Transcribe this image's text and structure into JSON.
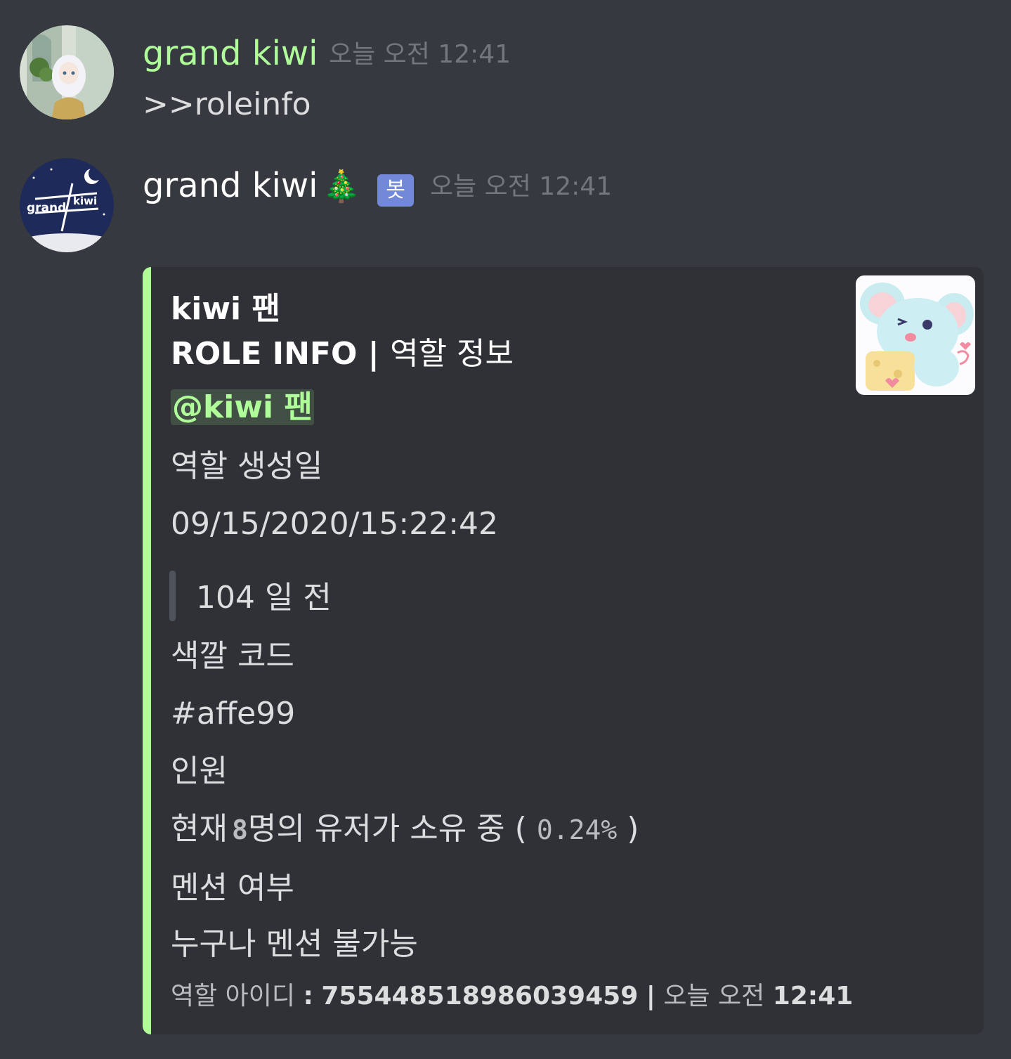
{
  "messages": [
    {
      "author": "grand kiwi",
      "author_color": "#affe99",
      "timestamp": "오늘 오전 12:41",
      "content": ">>roleinfo"
    },
    {
      "author": "grand kiwi",
      "author_emoji": "🎄",
      "author_color": "#ffffff",
      "bot_tag": "봇",
      "timestamp": "오늘 오전 12:41",
      "avatar_text": {
        "left": "grand",
        "right": "kiwi"
      },
      "embed": {
        "accent_color": "#affe99",
        "author": "kiwi 팬",
        "title_bold": "ROLE INFO |",
        "title_rest": "역할 정보",
        "mention": "@kiwi 팬",
        "created_label": "역할 생성일",
        "created_value": "09/15/2020/15:22:42",
        "created_quote": "104 일 전",
        "color_label": "색깔 코드",
        "color_value": "#affe99",
        "members_label": "인원",
        "members_prefix": "현재",
        "members_count": "8",
        "members_suffix": "명의 유저가 소유 중",
        "members_open": "(",
        "members_percent": "0.24%",
        "members_close": ")",
        "mention_label": "멘션 여부",
        "mention_value": "누구나 멘션 불가능",
        "footer_label": "역할 아이디",
        "footer_sep": ":",
        "footer_id": "755448518986039459",
        "footer_pipe": "|",
        "footer_day": "오늘 오전",
        "footer_time": "12:41"
      }
    }
  ]
}
